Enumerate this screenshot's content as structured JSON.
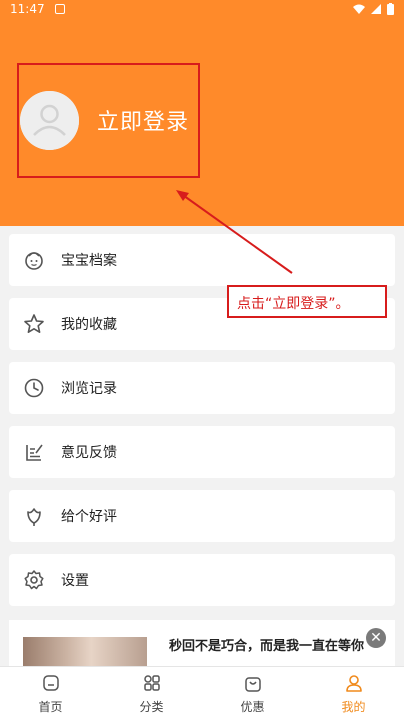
{
  "status_bar": {
    "time": "11:47"
  },
  "profile": {
    "login_label": "立即登录"
  },
  "menu": [
    {
      "label": "宝宝档案",
      "icon": "baby-face-icon"
    },
    {
      "label": "我的收藏",
      "icon": "star-icon"
    },
    {
      "label": "浏览记录",
      "icon": "clock-icon"
    },
    {
      "label": "意见反馈",
      "icon": "edit-note-icon"
    },
    {
      "label": "给个好评",
      "icon": "flower-icon"
    },
    {
      "label": "设置",
      "icon": "gear-icon"
    }
  ],
  "annotation": {
    "text": "点击“立即登录”。"
  },
  "ad": {
    "text": "秒回不是巧合，而是我一直在等你",
    "close": "✕"
  },
  "bottom_nav": [
    {
      "label": "首页",
      "icon": "home-icon"
    },
    {
      "label": "分类",
      "icon": "category-icon"
    },
    {
      "label": "优惠",
      "icon": "shopping-bag-icon"
    },
    {
      "label": "我的",
      "icon": "user-icon",
      "active": true
    }
  ],
  "colors": {
    "header": "#ff8a2a",
    "highlight": "#d71c1c",
    "active_tab": "#f08a1c"
  }
}
